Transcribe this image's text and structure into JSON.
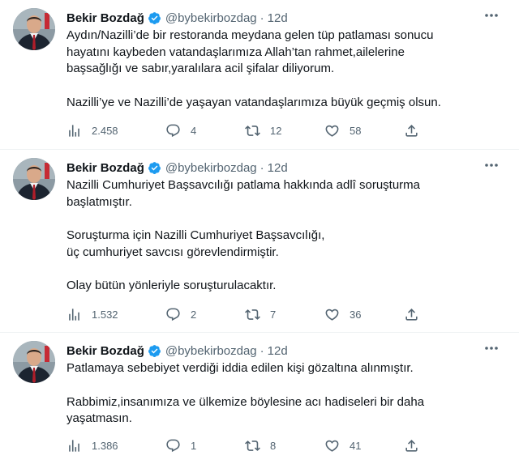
{
  "colors": {
    "text": "#0f1419",
    "secondary": "#536471",
    "verified": "#1d9bf0",
    "divider": "#eff3f4"
  },
  "tweets": [
    {
      "author_name": "Bekir Bozdağ",
      "handle": "@bybekirbozdag",
      "separator": "·",
      "time": "12d",
      "paragraphs": [
        "Aydın/Nazilli’de bir restoranda meydana gelen tüp patlaması sonucu hayatını kaybeden vatandaşlarımıza Allah’tan rahmet,ailelerine başsağlığı ve sabır,yaralılara acil şifalar diliyorum.",
        "Nazilli’ye ve Nazilli’de yaşayan vatandaşlarımıza büyük geçmiş olsun."
      ],
      "views": "2.458",
      "replies": "4",
      "retweets": "12",
      "likes": "58"
    },
    {
      "author_name": "Bekir Bozdağ",
      "handle": "@bybekirbozdag",
      "separator": "·",
      "time": "12d",
      "paragraphs": [
        "Nazilli Cumhuriyet Başsavcılığı patlama hakkında adlî soruşturma başlatmıştır.",
        "Soruşturma için Nazilli Cumhuriyet Başsavcılığı,\nüç cumhuriyet savcısı görevlendirmiştir.",
        "Olay bütün yönleriyle soruşturulacaktır."
      ],
      "views": "1.532",
      "replies": "2",
      "retweets": "7",
      "likes": "36"
    },
    {
      "author_name": "Bekir Bozdağ",
      "handle": "@bybekirbozdag",
      "separator": "·",
      "time": "12d",
      "paragraphs": [
        "Patlamaya sebebiyet verdiği iddia edilen kişi gözaltına alınmıştır.",
        "Rabbimiz,insanımıza ve ülkemize böylesine acı hadiseleri bir daha yaşatmasın."
      ],
      "views": "1.386",
      "replies": "1",
      "retweets": "8",
      "likes": "41"
    }
  ]
}
